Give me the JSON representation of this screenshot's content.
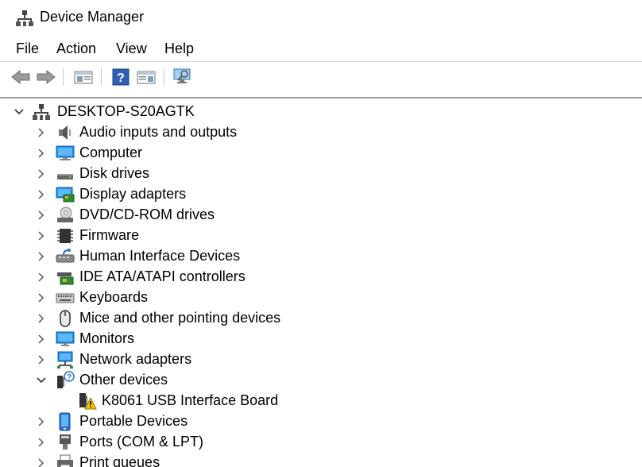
{
  "window": {
    "title": "Device Manager"
  },
  "menu": [
    "File",
    "Action",
    "View",
    "Help"
  ],
  "toolbar": {
    "buttons": [
      "back-icon",
      "forward-icon",
      "properties-pane-icon",
      "help-icon",
      "action-pane-icon",
      "scan-hardware-icon"
    ]
  },
  "tree": {
    "root": "DESKTOP-S20AGTK",
    "items": [
      {
        "label": "Audio inputs and outputs",
        "icon": "speaker-icon",
        "expanded": false
      },
      {
        "label": "Computer",
        "icon": "computer-icon",
        "expanded": false
      },
      {
        "label": "Disk drives",
        "icon": "disk-drive-icon",
        "expanded": false
      },
      {
        "label": "Display adapters",
        "icon": "display-adapter-icon",
        "expanded": false
      },
      {
        "label": "DVD/CD-ROM drives",
        "icon": "dvd-drive-icon",
        "expanded": false
      },
      {
        "label": "Firmware",
        "icon": "firmware-icon",
        "expanded": false
      },
      {
        "label": "Human Interface Devices",
        "icon": "hid-icon",
        "expanded": false
      },
      {
        "label": "IDE ATA/ATAPI controllers",
        "icon": "ide-controller-icon",
        "expanded": false
      },
      {
        "label": "Keyboards",
        "icon": "keyboard-icon",
        "expanded": false
      },
      {
        "label": "Mice and other pointing devices",
        "icon": "mouse-icon",
        "expanded": false
      },
      {
        "label": "Monitors",
        "icon": "monitor-icon",
        "expanded": false
      },
      {
        "label": "Network adapters",
        "icon": "network-adapter-icon",
        "expanded": false
      },
      {
        "label": "Other devices",
        "icon": "other-devices-icon",
        "expanded": true,
        "children": [
          {
            "label": "K8061 USB Interface Board",
            "icon": "warning-device-icon"
          }
        ]
      },
      {
        "label": "Portable Devices",
        "icon": "portable-device-icon",
        "expanded": false
      },
      {
        "label": "Ports (COM & LPT)",
        "icon": "port-icon",
        "expanded": false
      },
      {
        "label": "Print queues",
        "icon": "printer-icon",
        "expanded": false
      }
    ]
  }
}
